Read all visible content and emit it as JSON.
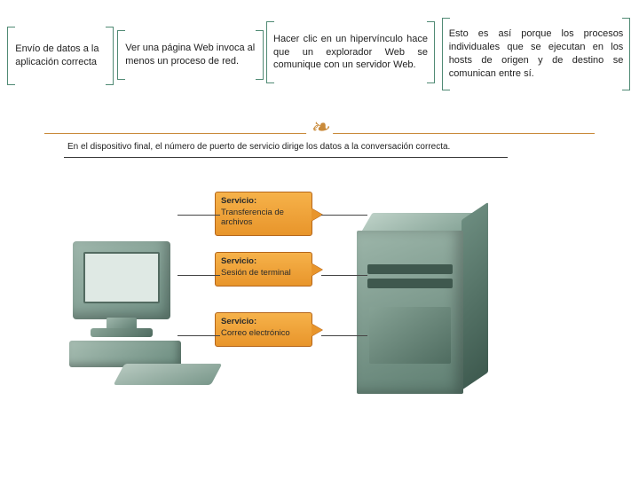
{
  "top": {
    "col1": "Envío de datos a la aplicación correcta",
    "col2": "Ver una página Web invoca al menos un proceso de red.",
    "col3": "Hacer clic en un hipervínculo hace que un explorador Web se comunique con un servidor Web.",
    "col4": "Esto es así porque los procesos individuales que se ejecutan en los hosts de origen y de destino se comunican entre sí."
  },
  "divider_glyph": "❧",
  "figure": {
    "caption": "En el dispositivo final, el número de puerto de servicio dirige los datos a la conversación correcta.",
    "services": [
      {
        "title": "Servicio:",
        "desc": "Transferencia de archivos"
      },
      {
        "title": "Servicio:",
        "desc": "Sesión de terminal"
      },
      {
        "title": "Servicio:",
        "desc": "Correo electrónico"
      }
    ]
  }
}
